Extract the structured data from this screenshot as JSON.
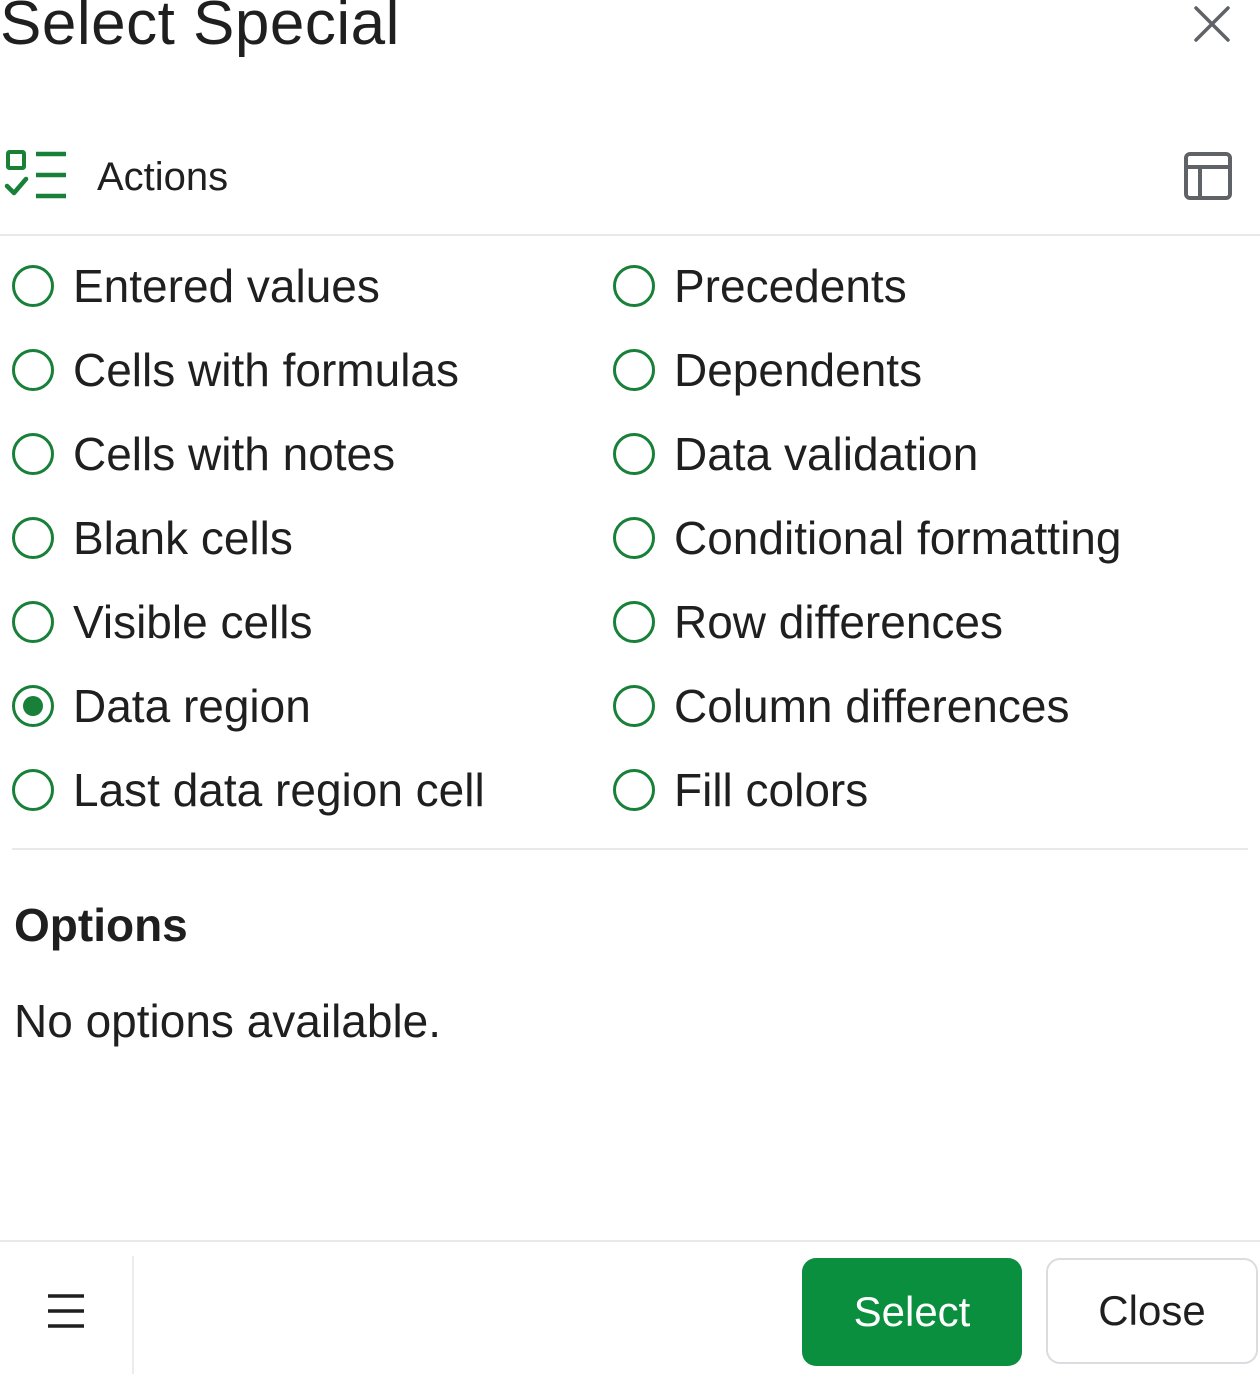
{
  "dialog": {
    "title": "Select Special",
    "close_icon": "close-icon"
  },
  "actions_section": {
    "label": "Actions",
    "icon": "checklist-icon",
    "layout_icon": "table-layout-icon"
  },
  "radio_options": {
    "left_column": [
      {
        "label": "Entered values",
        "checked": false
      },
      {
        "label": "Cells with formulas",
        "checked": false
      },
      {
        "label": "Cells with notes",
        "checked": false
      },
      {
        "label": "Blank cells",
        "checked": false
      },
      {
        "label": "Visible cells",
        "checked": false
      },
      {
        "label": "Data region",
        "checked": true
      },
      {
        "label": "Last data region cell",
        "checked": false
      }
    ],
    "right_column": [
      {
        "label": "Precedents",
        "checked": false
      },
      {
        "label": "Dependents",
        "checked": false
      },
      {
        "label": "Data validation",
        "checked": false
      },
      {
        "label": "Conditional formatting",
        "checked": false
      },
      {
        "label": "Row differences",
        "checked": false
      },
      {
        "label": "Column differences",
        "checked": false
      },
      {
        "label": "Fill colors",
        "checked": false
      }
    ]
  },
  "options_section": {
    "heading": "Options",
    "empty_text": "No options available."
  },
  "footer": {
    "menu_icon": "hamburger-menu-icon",
    "select_label": "Select",
    "close_label": "Close"
  },
  "colors": {
    "accent": "#188038",
    "primary_button": "#0a8f3f",
    "text": "#1f1f1f",
    "divider": "#e9e9e9"
  }
}
